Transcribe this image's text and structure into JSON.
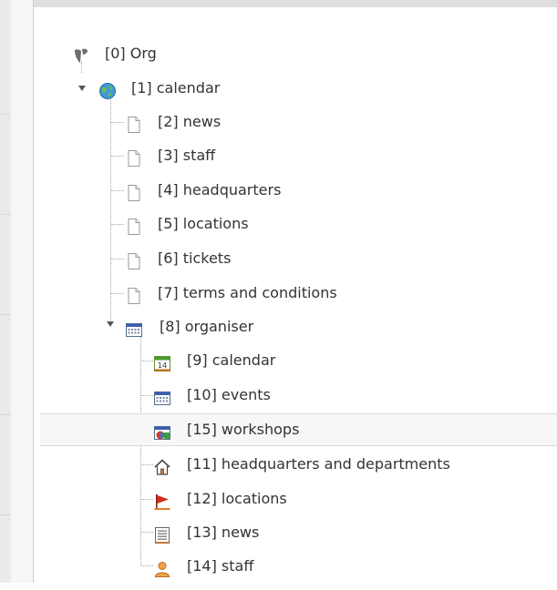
{
  "tree": {
    "nodes": [
      {
        "label": "[0] Org",
        "icon": "typo3-logo-icon"
      },
      {
        "label": "[1] calendar",
        "icon": "globe-icon"
      },
      {
        "label": "[2] news",
        "icon": "page-icon"
      },
      {
        "label": "[3] staff",
        "icon": "page-icon"
      },
      {
        "label": "[4] headquarters",
        "icon": "page-icon"
      },
      {
        "label": "[5] locations",
        "icon": "page-icon"
      },
      {
        "label": "[6] tickets",
        "icon": "page-icon"
      },
      {
        "label": "[7] terms and conditions",
        "icon": "page-icon"
      },
      {
        "label": "[8] organiser",
        "icon": "calendar-folder-icon"
      },
      {
        "label": "[9] calendar",
        "icon": "calendar-14-icon"
      },
      {
        "label": "[10] events",
        "icon": "calendar-grid-icon"
      },
      {
        "label": "[15] workshops",
        "icon": "workshops-icon"
      },
      {
        "label": "[11] headquarters and departments",
        "icon": "house-icon"
      },
      {
        "label": "[12] locations",
        "icon": "red-flag-icon"
      },
      {
        "label": "[13] news",
        "icon": "news-list-icon"
      },
      {
        "label": "[14] staff",
        "icon": "person-icon"
      }
    ],
    "calendar_icon_day": "14",
    "highlighted": "[15] workshops"
  }
}
